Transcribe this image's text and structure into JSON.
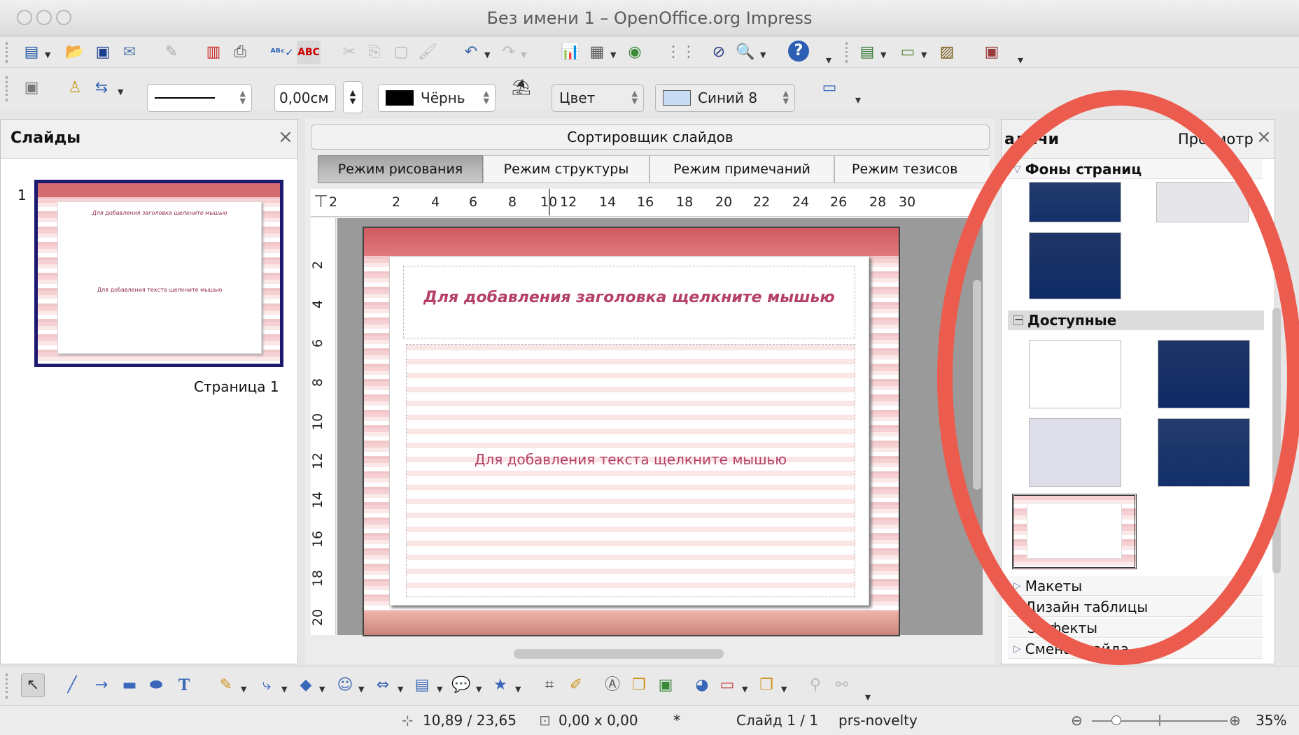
{
  "window": {
    "title": "Без имени 1 – OpenOffice.org Impress"
  },
  "toolbar2": {
    "line_width": "0,00см",
    "line_color": "Чёрнь",
    "area_style": "Цвет",
    "area_fill": "Синий 8",
    "colors": {
      "line_color": "#000000",
      "fill_color": "#c8dcf4"
    }
  },
  "slides_panel": {
    "title": "Слайды",
    "close": "×",
    "slide_number": "1",
    "slide_label": "Страница 1",
    "thumb_title": "Для добавления заголовка щелкните мышью",
    "thumb_text": "Для добавления текста щелкните мышью"
  },
  "editor": {
    "sorter_title": "Сортировщик слайдов",
    "tabs": [
      {
        "label": "Режим рисования"
      },
      {
        "label": "Режим структуры"
      },
      {
        "label": "Режим примечаний"
      },
      {
        "label": "Режим тезисов"
      }
    ],
    "h_ruler": [
      "2",
      "2",
      "4",
      "6",
      "8",
      "10",
      "12",
      "14",
      "16",
      "18",
      "20",
      "22",
      "24",
      "26",
      "28",
      "30"
    ],
    "v_ruler": [
      "2",
      "4",
      "6",
      "8",
      "10",
      "12",
      "14",
      "16",
      "18",
      "20"
    ],
    "slide_title_placeholder": "Для добавления заголовка щелкните мышью",
    "slide_text_placeholder": "Для добавления текста щелкните мышью"
  },
  "tasks": {
    "title": "адачи",
    "view_label": "Просмотр",
    "close": "×",
    "sections": {
      "page_backgrounds": "Фоны страниц",
      "available": "Доступные",
      "layouts": "Макеты",
      "table_design": "Дизайн таблицы",
      "effects": "Эффекты",
      "transition": "Смена слайда"
    }
  },
  "statusbar": {
    "position": "10,89 / 23,65",
    "size": "0,00 x 0,00",
    "modified": "*",
    "slide": "Слайд 1 / 1",
    "master": "prs-novelty",
    "zoom": "35%"
  },
  "colors": {
    "annotation_circle": "#ec5c4e",
    "slide_title": "#b5406a",
    "slide_text": "#b5406a",
    "thumb_border": "#1c1a6e"
  }
}
